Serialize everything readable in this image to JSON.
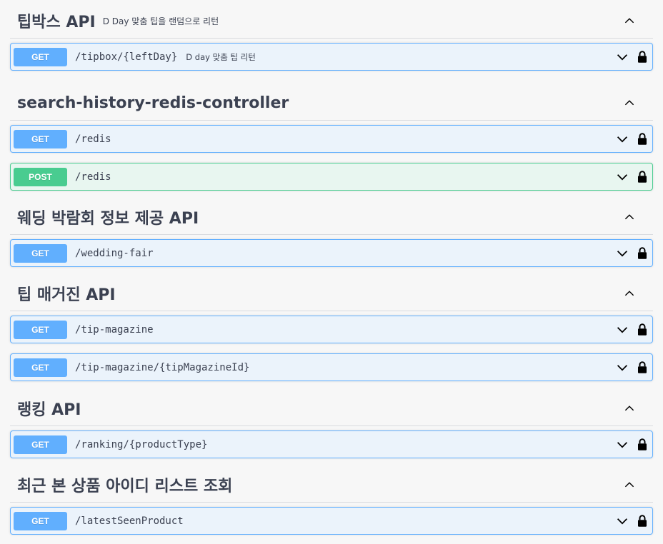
{
  "sections": [
    {
      "title": "팁박스 API",
      "description": "D Day 맞춤 팁을 랜덤으로 리턴",
      "operations": [
        {
          "method": "GET",
          "path": "/tipbox/{leftDay}",
          "summary": "D day 맞춤 팁 리턴"
        }
      ]
    },
    {
      "title": "search-history-redis-controller",
      "operations": [
        {
          "method": "GET",
          "path": "/redis"
        },
        {
          "method": "POST",
          "path": "/redis"
        }
      ]
    },
    {
      "title": "웨딩 박람회 정보 제공 API",
      "operations": [
        {
          "method": "GET",
          "path": "/wedding-fair"
        }
      ]
    },
    {
      "title": "팁 매거진 API",
      "operations": [
        {
          "method": "GET",
          "path": "/tip-magazine"
        },
        {
          "method": "GET",
          "path": "/tip-magazine/{tipMagazineId}"
        }
      ]
    },
    {
      "title": "랭킹 API",
      "operations": [
        {
          "method": "GET",
          "path": "/ranking/{productType}"
        }
      ]
    },
    {
      "title": "최근 본 상품 아이디 리스트 조회",
      "operations": [
        {
          "method": "GET",
          "path": "/latestSeenProduct"
        }
      ]
    }
  ],
  "colors": {
    "get": "#61affe",
    "get_bg": "#ebf3fb",
    "post": "#49cc90",
    "post_bg": "#e8f6f0",
    "text": "#3b4151"
  },
  "icons": {
    "section_toggle": "chevron-up-icon",
    "operation_toggle": "chevron-down-icon",
    "auth": "lock-icon"
  }
}
